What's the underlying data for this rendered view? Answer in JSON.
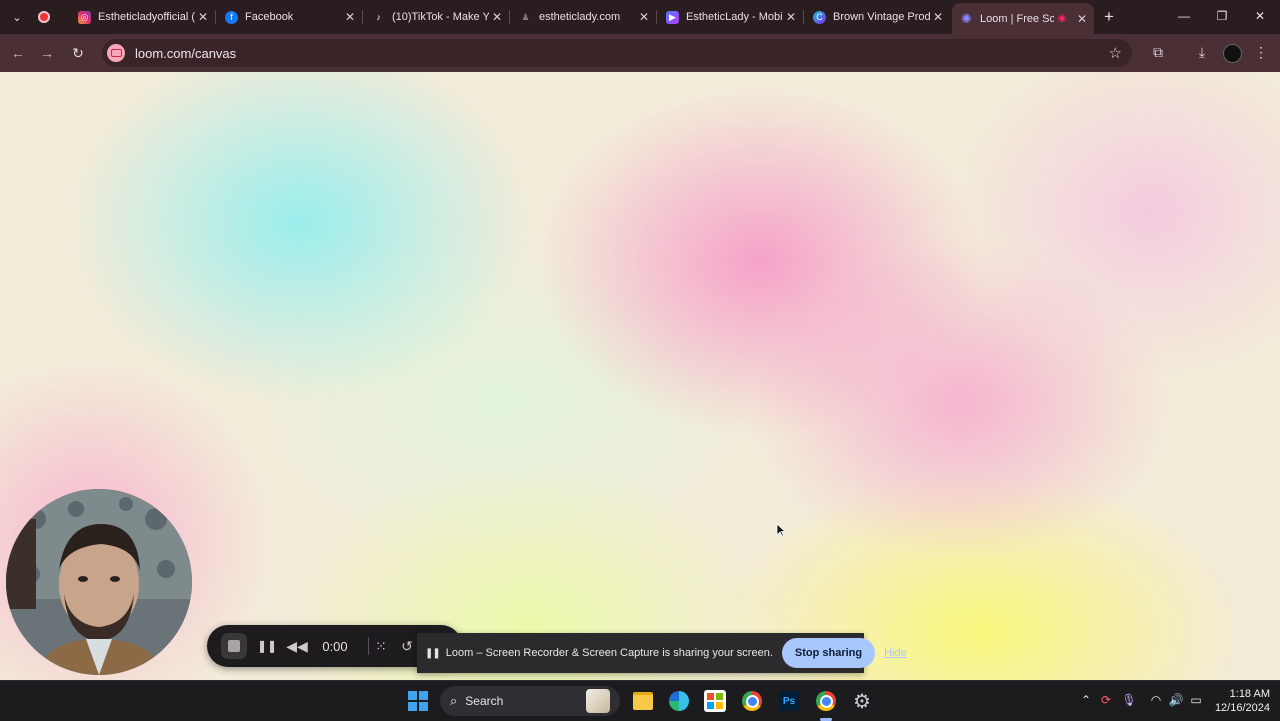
{
  "browser": {
    "tabs": [
      {
        "title": "Estheticladyofficial (",
        "favicon": "instagram-icon",
        "color": "#e1306c"
      },
      {
        "title": "Facebook",
        "favicon": "facebook-icon",
        "color": "#1877f2"
      },
      {
        "title": "(10)TikTok - Make Y",
        "favicon": "tiktok-icon",
        "color": "#111111"
      },
      {
        "title": "estheticlady.com",
        "favicon": "site-icon",
        "color": "#6b5a5d"
      },
      {
        "title": "EstheticLady - Mobi",
        "favicon": "video-icon",
        "color": "#7b3fe4"
      },
      {
        "title": "Brown Vintage Prod",
        "favicon": "canva-icon",
        "color": "#1da1c8"
      },
      {
        "title": "Loom | Free Scr",
        "favicon": "loom-icon",
        "color": "#625df5",
        "active": true
      }
    ],
    "url": "loom.com/canvas"
  },
  "loom_controls": {
    "timer": "0:00"
  },
  "share_bar": {
    "message": "Loom – Screen Recorder & Screen Capture is sharing your screen.",
    "stop_label": "Stop sharing",
    "hide_label": "Hide"
  },
  "taskbar": {
    "search_label": "Search",
    "time": "1:18 AM",
    "date": "12/16/2024"
  },
  "colors": {
    "tabstrip_bg": "#2a1d1f",
    "toolbar_bg": "#4a2f34",
    "stop_sharing_bg": "#a8c7fa",
    "taskbar_bg": "#1c1c1f"
  }
}
